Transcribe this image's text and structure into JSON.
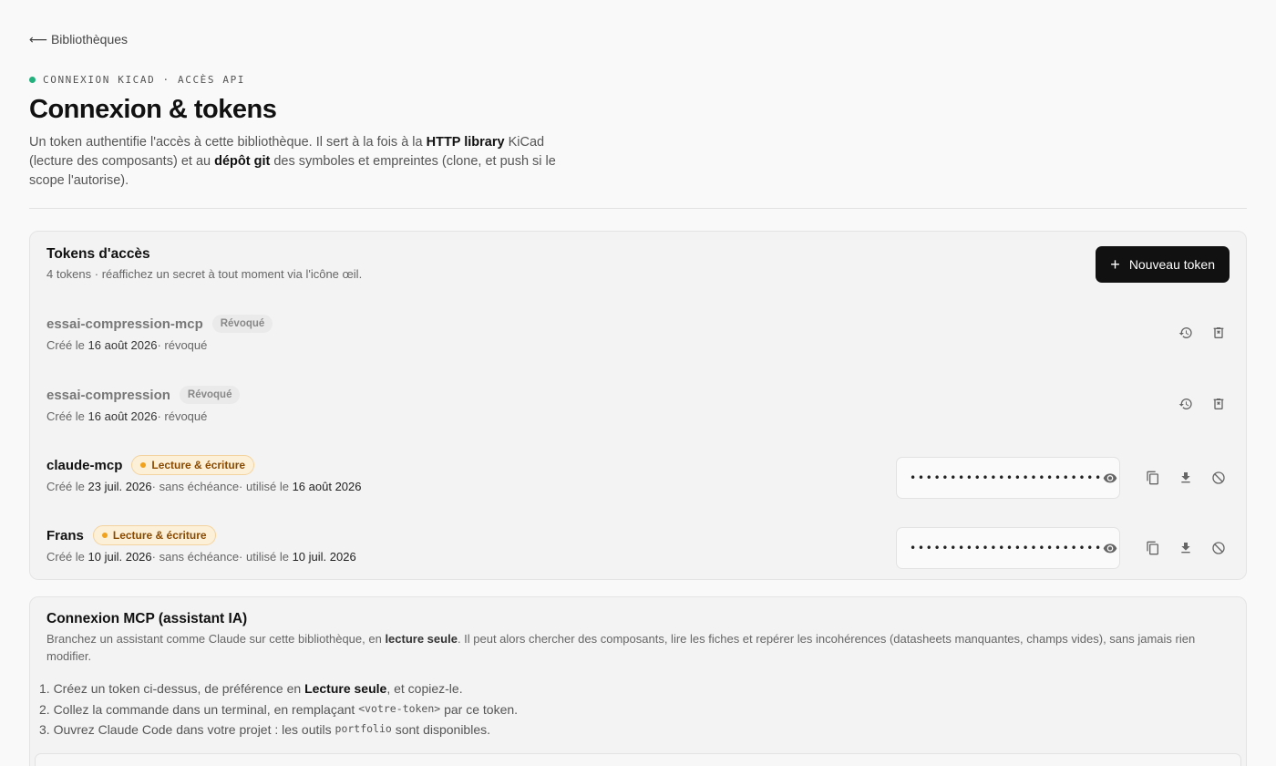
{
  "nav": {
    "back_label": "⟵ Bibliothèques"
  },
  "header": {
    "eyebrow": "CONNEXION KICAD · ACCÈS API",
    "title": "Connexion & tokens",
    "intro_1": "Un token authentifie l'accès à cette bibliothèque. Il sert à la fois à la ",
    "intro_b1": "HTTP library",
    "intro_2": " KiCad (lecture des composants) et au ",
    "intro_b2": "dépôt git",
    "intro_3": " des symboles et empreintes (clone, et push si le scope l'autorise)."
  },
  "tokens": {
    "title": "Tokens d'accès",
    "subtitle": "4 tokens · réaffichez un secret à tout moment via l'icône œil.",
    "new_button": "Nouveau token",
    "items": [
      {
        "name": "essai-compression-mcp",
        "badge": "Révoqué",
        "created_prefix": "Créé le ",
        "created": "16 août 2026",
        "tail": "· révoqué"
      },
      {
        "name": "essai-compression",
        "badge": "Révoqué",
        "created_prefix": "Créé le ",
        "created": "16 août 2026",
        "tail": "· révoqué"
      },
      {
        "name": "claude-mcp",
        "badge": "Lecture & écriture",
        "created_prefix": "Créé le ",
        "created": "23 juil. 2026",
        "mid": "· sans échéance· utilisé le ",
        "used": "16 août 2026",
        "secret": "••••••••••••••••••••••••"
      },
      {
        "name": "Frans",
        "badge": "Lecture & écriture",
        "created_prefix": "Créé le ",
        "created": "10 juil. 2026",
        "mid": "· sans échéance· utilisé le ",
        "used": "10 juil. 2026",
        "secret": "••••••••••••••••••••••••"
      }
    ]
  },
  "mcp": {
    "title": "Connexion MCP (assistant IA)",
    "desc_1": "Branchez un assistant comme Claude sur cette bibliothèque, en ",
    "desc_b": "lecture seule",
    "desc_2": ". Il peut alors chercher des composants, lire les fiches et repérer les incohérences (datasheets manquantes, champs vides), sans jamais rien modifier.",
    "step1_a": "1. Créez un token ci-dessus, de préférence en ",
    "step1_b": "Lecture seule",
    "step1_c": ", et copiez-le.",
    "step2_a": "2. Collez la commande dans un terminal, en remplaçant ",
    "step2_code": "<votre-token>",
    "step2_c": " par ce token.",
    "step3_a": "3. Ouvrez Claude Code dans votre projet : les outils ",
    "step3_code": "portfolio",
    "step3_c": " sont disponibles."
  },
  "colors": {
    "accent_green": "#22b07d",
    "badge_amber": "#f0a21c",
    "primary_button": "#111111"
  }
}
